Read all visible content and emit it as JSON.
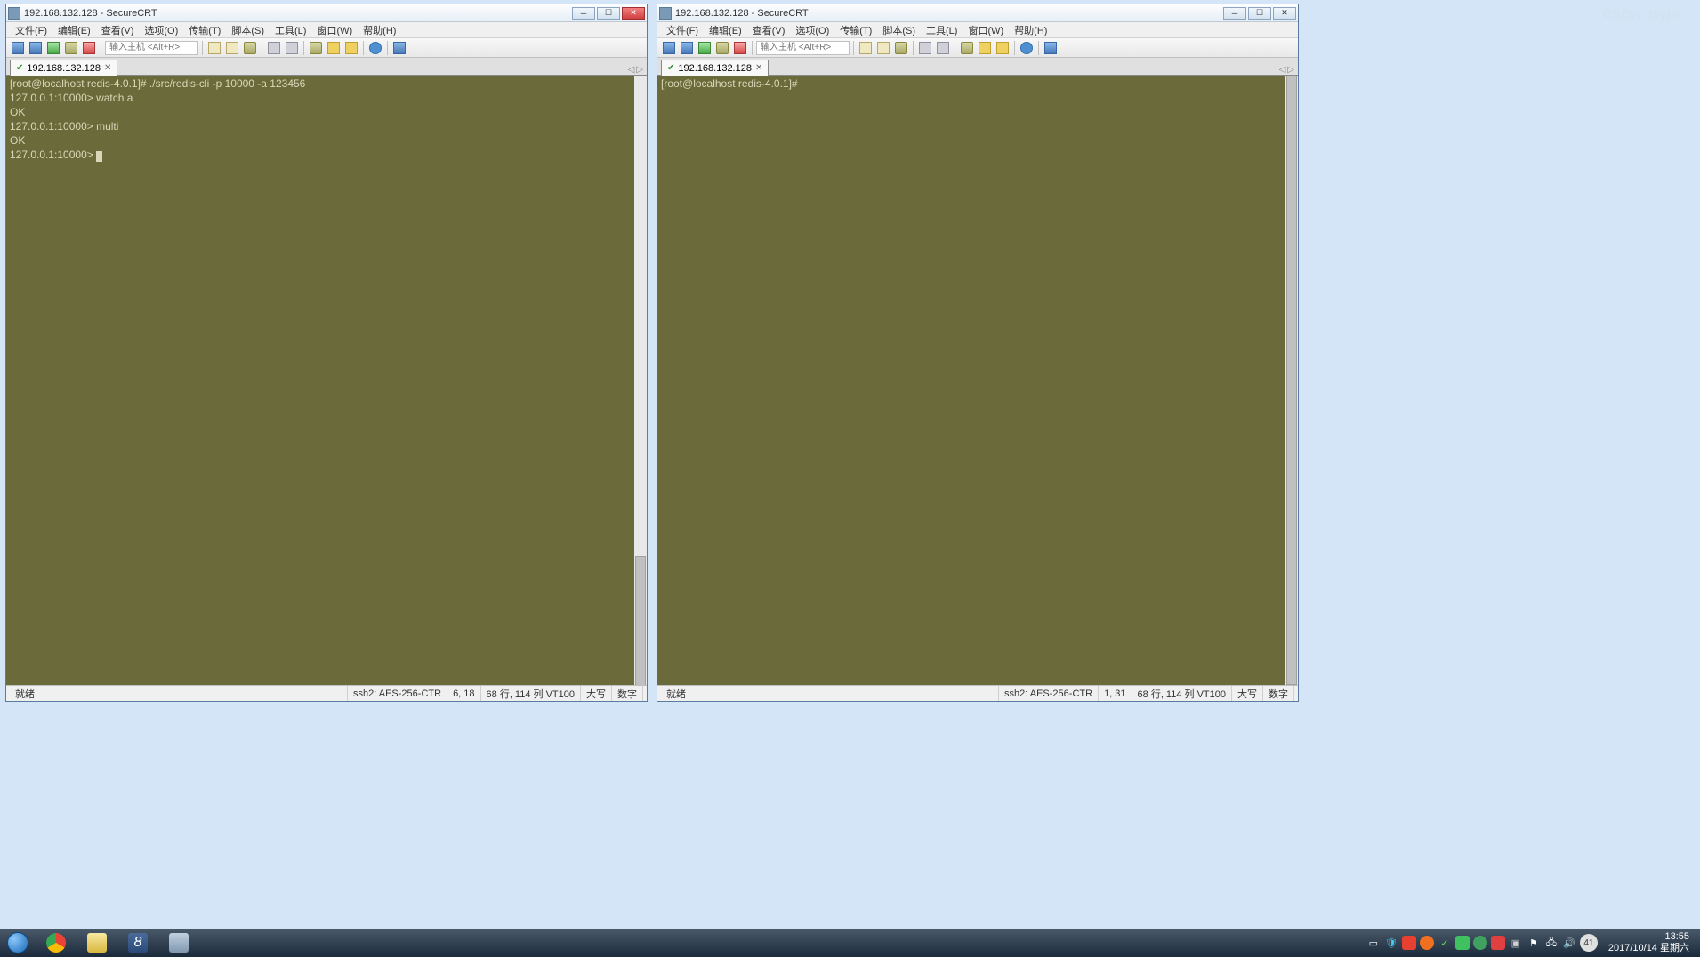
{
  "left": {
    "title": "192.168.132.128 - SecureCRT",
    "menu": [
      "文件(F)",
      "编辑(E)",
      "查看(V)",
      "选项(O)",
      "传输(T)",
      "脚本(S)",
      "工具(L)",
      "窗口(W)",
      "帮助(H)"
    ],
    "host_placeholder": "输入主机 <Alt+R>",
    "tab_label": "192.168.132.128",
    "terminal_lines": [
      "[root@localhost redis-4.0.1]# ./src/redis-cli -p 10000 -a 123456",
      "127.0.0.1:10000> watch a",
      "OK",
      "127.0.0.1:10000> multi",
      "OK",
      "127.0.0.1:10000> "
    ],
    "status": {
      "ready": "就绪",
      "conn": "ssh2: AES-256-CTR",
      "pos": "6,  18",
      "size": "68 行, 114 列 VT100",
      "caps": "大写",
      "num": "数字"
    }
  },
  "right": {
    "title": "192.168.132.128 - SecureCRT",
    "menu": [
      "文件(F)",
      "编辑(E)",
      "查看(V)",
      "选项(O)",
      "传输(T)",
      "脚本(S)",
      "工具(L)",
      "窗口(W)",
      "帮助(H)"
    ],
    "host_placeholder": "输入主机 <Alt+R>",
    "tab_label": "192.168.132.128",
    "terminal_lines": [
      "[root@localhost redis-4.0.1]# "
    ],
    "status": {
      "ready": "就绪",
      "conn": "ssh2: AES-256-CTR",
      "pos": "1,  31",
      "size": "68 行, 114 列 VT100",
      "caps": "大写",
      "num": "数字"
    }
  },
  "taskbar": {
    "time": "13:55",
    "date": "2017/10/14 星期六",
    "lang": "41"
  },
  "watermark": "CSDN @yjin"
}
